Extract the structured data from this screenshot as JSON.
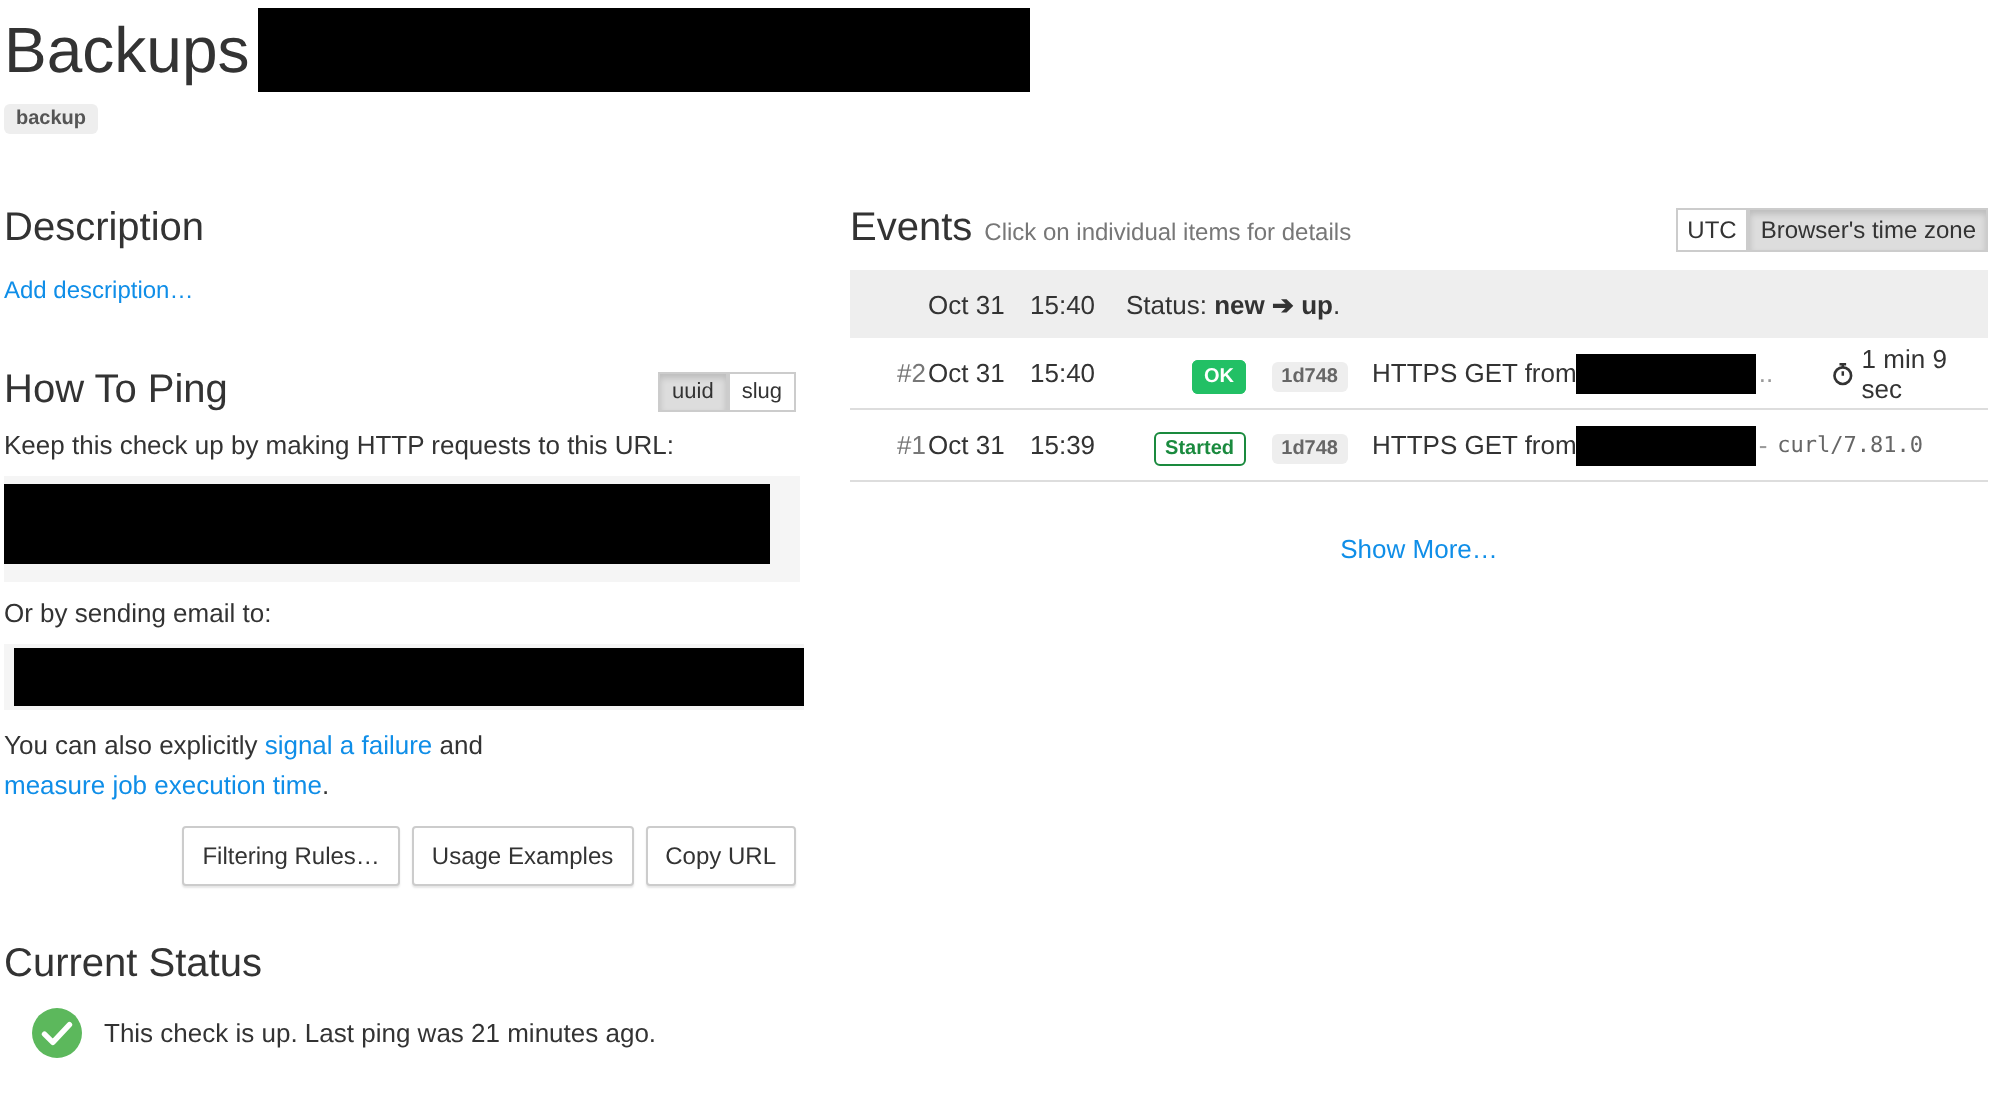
{
  "title": "Backups",
  "tags": [
    "backup"
  ],
  "description": {
    "heading": "Description",
    "link": "Add description…"
  },
  "how_to_ping": {
    "heading": "How To Ping",
    "url_format": [
      {
        "label": "uuid",
        "selected": true
      },
      {
        "label": "slug",
        "selected": false
      }
    ],
    "intro": "Keep this check up by making HTTP requests to this URL:",
    "email_label": "Or by sending email to:",
    "note": {
      "before": "You can also explicitly",
      "link_1": "signal a failure",
      "middle": "and",
      "link_2": "measure job execution time",
      "after": "."
    },
    "buttons": [
      "Filtering Rules…",
      "Usage Examples",
      "Copy URL"
    ]
  },
  "current_status": {
    "heading": "Current Status",
    "up": true,
    "text": "This check is up. Last ping was 21 minutes ago."
  },
  "events": {
    "heading": "Events",
    "hint": "Click on individual items for details",
    "timezones": [
      {
        "label": "UTC",
        "selected": false
      },
      {
        "label": "Browser's time zone",
        "selected": true
      }
    ],
    "rows": [
      {
        "kind": "flip",
        "date": "Oct 31",
        "time": "15:40",
        "text": "Status: **new ➔ up**."
      },
      {
        "kind": "ping",
        "number": "#2",
        "date": "Oct 31",
        "time": "15:40",
        "badge": {
          "label": "OK",
          "filled": true,
          "color": "#22c065"
        },
        "code": "1d748",
        "text": "HTTPS GET from",
        "suffix": "..",
        "agent": "",
        "duration": "1 min 9 sec"
      },
      {
        "kind": "ping",
        "number": "#1",
        "date": "Oct 31",
        "time": "15:39",
        "badge": {
          "label": "Started",
          "filled": false,
          "color": "#1a8a3e"
        },
        "code": "1d748",
        "text": "HTTPS GET from",
        "suffix": "-",
        "agent": "curl/7.81.0",
        "duration": ""
      }
    ],
    "show_more": "Show More…"
  }
}
